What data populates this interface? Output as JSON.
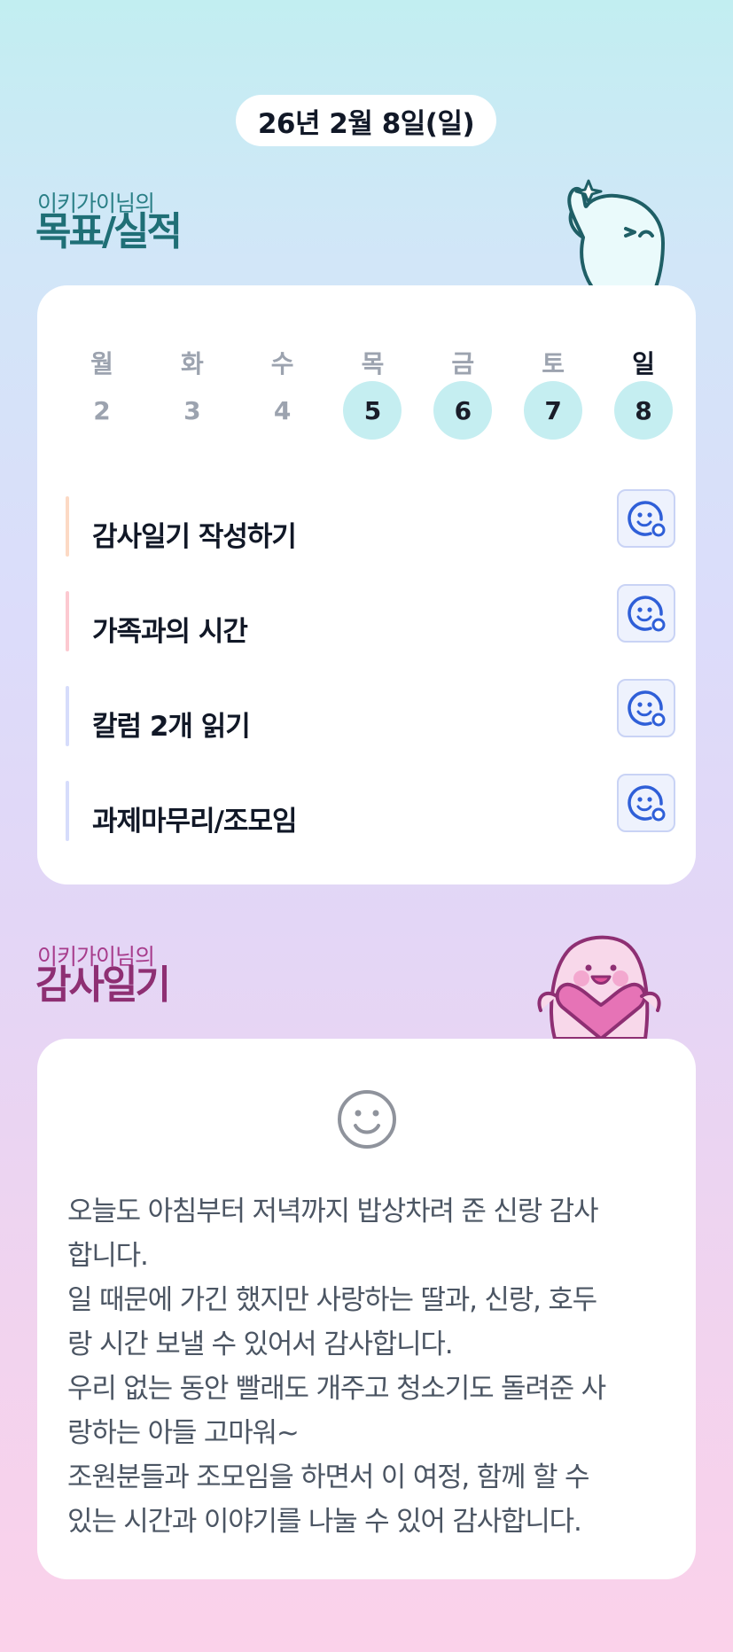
{
  "date_label": "26년 2월 8일(일)",
  "goals_section": {
    "subtitle": "이키가이님의",
    "title": "목표/실적"
  },
  "week": {
    "days": [
      "월",
      "화",
      "수",
      "목",
      "금",
      "토",
      "일"
    ],
    "dates": [
      "2",
      "3",
      "4",
      "5",
      "6",
      "7",
      "8"
    ],
    "active_dates": [
      "5",
      "6",
      "7",
      "8"
    ],
    "today": "8"
  },
  "goals": [
    {
      "label": "감사일기 작성하기",
      "bar_color": "#fcd9c4",
      "icon": "smile-edit-icon"
    },
    {
      "label": "가족과의 시간",
      "bar_color": "#fcc9d0",
      "icon": "smile-edit-icon"
    },
    {
      "label": "칼럼 2개 읽기",
      "bar_color": "#d6dcfb",
      "icon": "smile-edit-icon"
    },
    {
      "label": "과제마무리/조모임",
      "bar_color": "#d6dcfb",
      "icon": "smile-edit-icon"
    }
  ],
  "diary_section": {
    "subtitle": "이키가이님의",
    "title": "감사일기"
  },
  "diary": {
    "mood_icon": "smiley-icon",
    "lines": [
      "오늘도 아침부터 저녁까지 밥상차려 준 신랑 감사",
      "합니다.",
      "일 때문에 가긴 했지만 사랑하는 딸과, 신랑, 호두",
      "랑 시간 보낼 수 있어서 감사합니다.",
      "우리 없는 동안 빨래도 개주고 청소기도 돌려준 사",
      "랑하는 아들 고마워~",
      "조원분들과 조모임을 하면서 이 여정, 함께 할 수",
      "있는 시간과 이야기를 나눌 수 있어  감사합니다."
    ]
  },
  "colors": {
    "accent_blue": "#2f5fd8",
    "active_day_bg": "#c5eef1",
    "goal_title": "#1f6f76",
    "diary_title": "#8e2f73"
  }
}
